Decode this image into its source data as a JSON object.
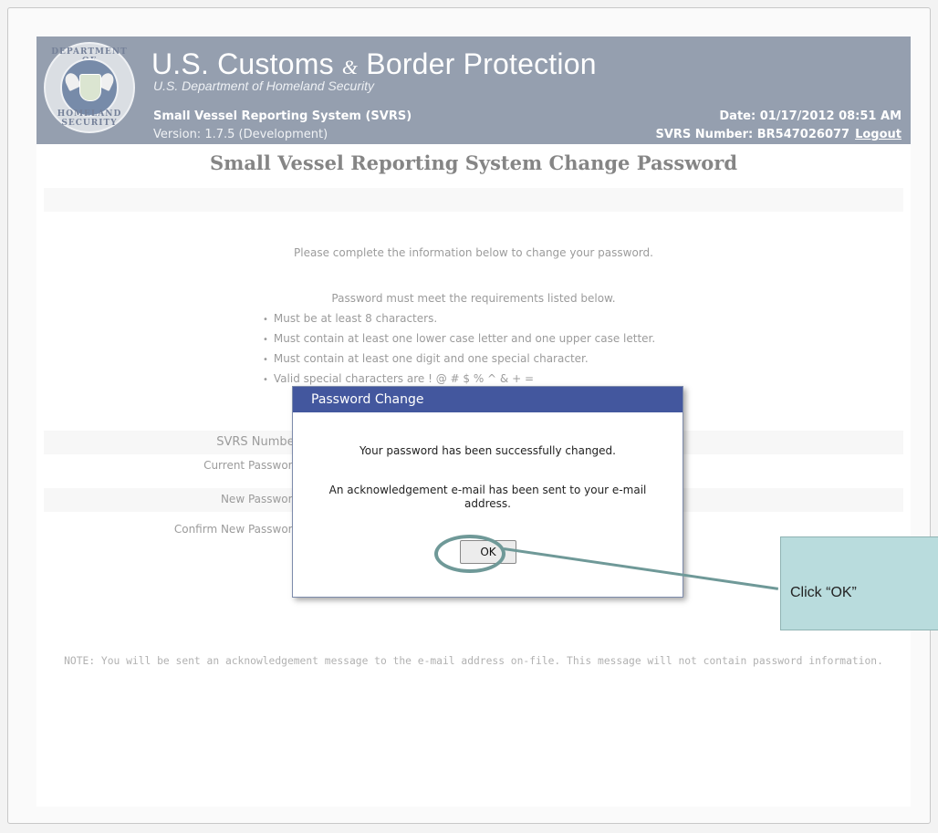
{
  "header": {
    "seal_text_top": "DEPARTMENT OF",
    "seal_text_bottom": "HOMELAND SECURITY",
    "agency_part1": "U.S. Customs ",
    "agency_amp": "&",
    "agency_part2": " Border Protection",
    "department": "U.S. Department of Homeland Security",
    "system_name": "Small Vessel Reporting System (SVRS)",
    "version": "Version: 1.7.5 (Development)",
    "date": "Date: 01/17/2012 08:51 AM",
    "svrs_number": "SVRS Number: BR547026077",
    "logout": "Logout",
    "colors": {
      "banner": "#5c6c84"
    }
  },
  "page": {
    "title": "Small Vessel Reporting System Change Password",
    "intro": "Please complete the information below to change your password.",
    "requirements_title": "Password must meet the requirements listed below.",
    "requirements": [
      "Must be at least 8 characters.",
      "Must contain at least one lower case letter and one upper case letter.",
      "Must contain at least one digit and one special character.",
      "Valid special characters are ! @ # $ % ^ & + ="
    ],
    "form": {
      "svrs_number_label": "SVRS Number",
      "current_password_label": "Current Password",
      "new_password_label": "New Password",
      "confirm_password_label": "Confirm New Password"
    },
    "note": "NOTE: You will be sent an acknowledgement message to the e-mail address on-file. This message will not contain password information."
  },
  "dialog": {
    "title": "Password Change",
    "message1": "Your password has been successfully changed.",
    "message2": "An acknowledgement e-mail has been sent to your e-mail address.",
    "ok_label": "OK",
    "colors": {
      "title_bar": "#43579e"
    }
  },
  "callout": {
    "text": "Click “OK”",
    "colors": {
      "box": "#b9dcdd",
      "ring": "#6f9998"
    }
  }
}
